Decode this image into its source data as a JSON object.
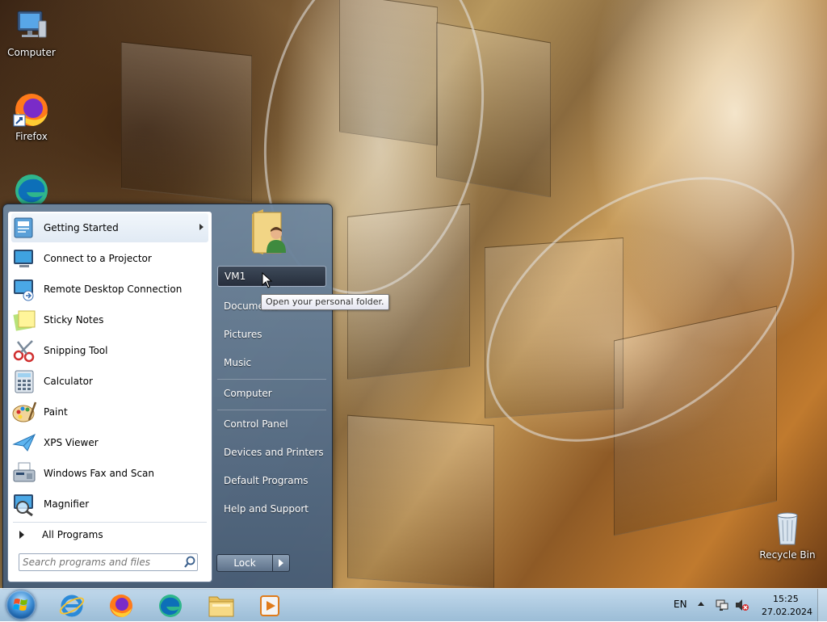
{
  "desktop": {
    "icons": [
      {
        "label": "Computer",
        "icon": "computer-icon"
      },
      {
        "label": "Firefox",
        "icon": "firefox-icon"
      },
      {
        "label": "",
        "icon": "edge-icon"
      },
      {
        "label": "Recycle Bin",
        "icon": "recycle-bin-icon"
      }
    ]
  },
  "start_menu": {
    "programs": [
      {
        "label": "Getting Started",
        "icon": "getting-started-icon",
        "submenu": true
      },
      {
        "label": "Connect to a Projector",
        "icon": "projector-icon"
      },
      {
        "label": "Remote Desktop Connection",
        "icon": "remote-desktop-icon"
      },
      {
        "label": "Sticky Notes",
        "icon": "sticky-notes-icon"
      },
      {
        "label": "Snipping Tool",
        "icon": "snipping-tool-icon"
      },
      {
        "label": "Calculator",
        "icon": "calculator-icon"
      },
      {
        "label": "Paint",
        "icon": "paint-icon"
      },
      {
        "label": "XPS Viewer",
        "icon": "xps-viewer-icon"
      },
      {
        "label": "Windows Fax and Scan",
        "icon": "fax-scan-icon"
      },
      {
        "label": "Magnifier",
        "icon": "magnifier-icon"
      }
    ],
    "all_programs": "All Programs",
    "search_placeholder": "Search programs and files",
    "right_items": [
      {
        "label": "VM1",
        "selected": true
      },
      {
        "label": "Documents"
      },
      {
        "label": "Pictures"
      },
      {
        "label": "Music"
      },
      {
        "label": "Computer"
      },
      {
        "label": "Control Panel"
      },
      {
        "label": "Devices and Printers"
      },
      {
        "label": "Default Programs"
      },
      {
        "label": "Help and Support"
      }
    ],
    "shutdown_label": "Lock",
    "tooltip": "Open your personal folder."
  },
  "taskbar": {
    "pinned": [
      "internet-explorer-icon",
      "firefox-icon",
      "edge-icon",
      "file-explorer-icon",
      "media-player-icon"
    ],
    "language": "EN",
    "time": "15:25",
    "date": "27.02.2024"
  }
}
